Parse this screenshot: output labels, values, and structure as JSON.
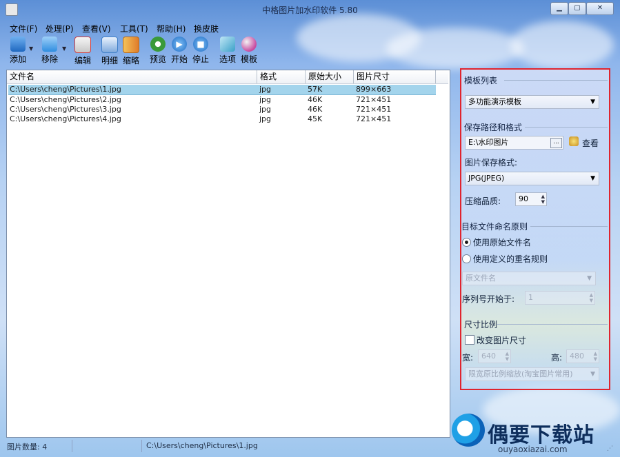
{
  "window": {
    "title": "中格图片加水印软件 5.80"
  },
  "menu": [
    "文件(F)",
    "处理(P)",
    "查看(V)",
    "工具(T)",
    "帮助(H)",
    "换皮肤"
  ],
  "toolbar": [
    {
      "label": "添加",
      "icon": "add-icon",
      "color": "#2b7bd0"
    },
    {
      "label": "移除",
      "icon": "remove-icon",
      "color": "#2f8de0"
    },
    {
      "label": "编辑",
      "icon": "edit-icon",
      "color": "#d23b3b"
    },
    {
      "label": "明细",
      "icon": "detail-icon",
      "color": "#3f7fc8"
    },
    {
      "label": "缩略",
      "icon": "thumbnail-icon",
      "color": "#e0a030"
    },
    {
      "label": "预览",
      "icon": "preview-icon",
      "color": "#3a9a3a"
    },
    {
      "label": "开始",
      "icon": "play-icon",
      "color": "#2a7fd4"
    },
    {
      "label": "停止",
      "icon": "stop-icon",
      "color": "#2a7fd4"
    },
    {
      "label": "选项",
      "icon": "options-icon",
      "color": "#3aa0c8"
    },
    {
      "label": "模板",
      "icon": "template-icon",
      "color": "#c84aa0"
    }
  ],
  "list": {
    "headers": [
      "文件名",
      "格式",
      "原始大小",
      "图片尺寸"
    ],
    "rows": [
      {
        "file": "C:\\Users\\cheng\\Pictures\\1.jpg",
        "format": "jpg",
        "size": "57K",
        "dims": "899×663",
        "selected": true
      },
      {
        "file": "C:\\Users\\cheng\\Pictures\\2.jpg",
        "format": "jpg",
        "size": "46K",
        "dims": "721×451",
        "selected": false
      },
      {
        "file": "C:\\Users\\cheng\\Pictures\\3.jpg",
        "format": "jpg",
        "size": "46K",
        "dims": "721×451",
        "selected": false
      },
      {
        "file": "C:\\Users\\cheng\\Pictures\\4.jpg",
        "format": "jpg",
        "size": "45K",
        "dims": "721×451",
        "selected": false
      }
    ]
  },
  "panel": {
    "template_list_title": "模板列表",
    "template_value": "多功能演示模板",
    "save_title": "保存路径和格式",
    "save_path": "E:\\水印图片",
    "browse_label": "...",
    "view_label": "查看",
    "format_label": "图片保存格式:",
    "format_value": "JPG(JPEG)",
    "quality_label": "压缩品质:",
    "quality_value": "90",
    "naming_title": "目标文件命名原则",
    "radio_original": "使用原始文件名",
    "radio_custom": "使用定义的重名规则",
    "name_source": "原文件名",
    "seq_label": "序列号开始于:",
    "seq_value": "1",
    "size_title": "尺寸比例",
    "resize_label": "改变图片尺寸",
    "width_label": "宽:",
    "width_value": "640",
    "height_label": "高:",
    "height_value": "480",
    "scale_mode": "限宽原比例缩放(淘宝图片常用)"
  },
  "status": {
    "count": "图片数量: 4",
    "path": "C:\\Users\\cheng\\Pictures\\1.jpg"
  },
  "watermark": {
    "title": "偶要下载站",
    "url": "ouyaoxiazai.com"
  }
}
